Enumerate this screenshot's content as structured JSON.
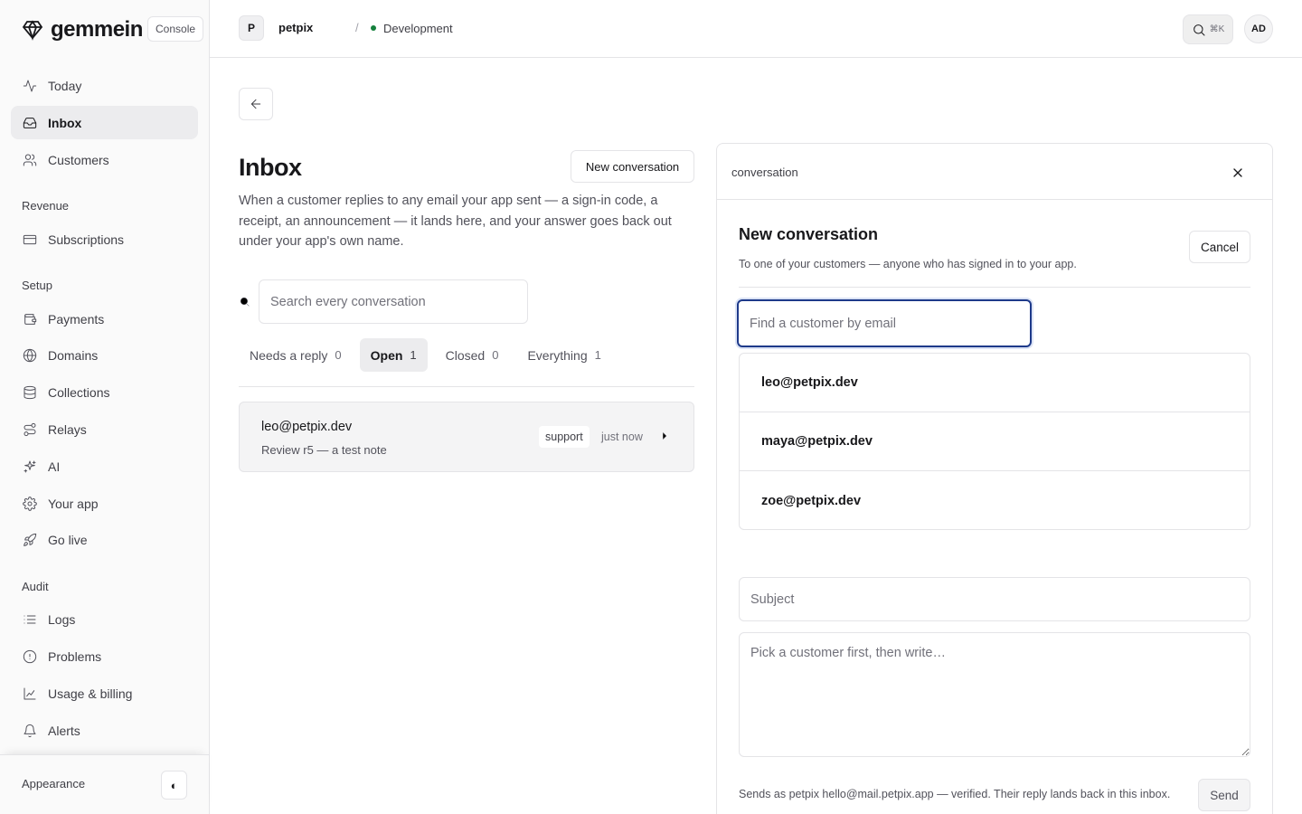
{
  "brand": {
    "name": "gemmein",
    "badge": "Console",
    "logo_icon": "gem-icon"
  },
  "sidebar": {
    "items": [
      {
        "label": "Today",
        "icon": "activity-icon",
        "active": false
      },
      {
        "label": "Inbox",
        "icon": "inbox-icon",
        "active": true
      },
      {
        "label": "Customers",
        "icon": "users-icon",
        "active": false
      }
    ],
    "sections": [
      {
        "title": "Revenue",
        "items": [
          {
            "label": "Subscriptions",
            "icon": "credit-card-icon"
          }
        ]
      },
      {
        "title": "Setup",
        "items": [
          {
            "label": "Payments",
            "icon": "wallet-icon"
          },
          {
            "label": "Domains",
            "icon": "globe-icon"
          },
          {
            "label": "Collections",
            "icon": "database-icon"
          },
          {
            "label": "Relays",
            "icon": "route-icon"
          },
          {
            "label": "AI",
            "icon": "sparkles-icon"
          },
          {
            "label": "Your app",
            "icon": "gear-icon"
          },
          {
            "label": "Go live",
            "icon": "rocket-icon"
          }
        ]
      },
      {
        "title": "Audit",
        "items": [
          {
            "label": "Logs",
            "icon": "list-icon"
          },
          {
            "label": "Problems",
            "icon": "alert-circle-icon"
          },
          {
            "label": "Usage & billing",
            "icon": "chart-icon"
          },
          {
            "label": "Alerts",
            "icon": "bell-icon"
          }
        ]
      }
    ],
    "footer": {
      "appearance_label": "Appearance",
      "toggle_glyph": "◐"
    }
  },
  "topbar": {
    "project_initial": "P",
    "project_name": "petpix",
    "separator": "/",
    "environment": "Development",
    "environment_color": "#15803d",
    "shortcut": "⌘K",
    "user_initials": "AD"
  },
  "main": {
    "title": "Inbox",
    "new_conversation_label": "New conversation",
    "description": "When a customer replies to any email your app sent — a sign-in code, a receipt, an announcement — it lands here, and your answer goes back out under your app's own name.",
    "search_placeholder": "Search every conversation",
    "tabs": [
      {
        "label": "Needs a reply",
        "count": "0",
        "active": false
      },
      {
        "label": "Open",
        "count": "1",
        "active": true
      },
      {
        "label": "Closed",
        "count": "0",
        "active": false
      },
      {
        "label": "Everything",
        "count": "1",
        "active": false
      }
    ],
    "conversations": [
      {
        "email": "leo@petpix.dev",
        "subject": "Review r5 — a test note",
        "tag": "support",
        "time": "just now"
      }
    ]
  },
  "panel": {
    "title": "conversation",
    "form_title": "New conversation",
    "form_subtitle": "To one of your customers — anyone who has signed in to your app.",
    "cancel_label": "Cancel",
    "find_placeholder": "Find a customer by email",
    "customers": [
      "leo@petpix.dev",
      "maya@petpix.dev",
      "zoe@petpix.dev"
    ],
    "subject_placeholder": "Subject",
    "body_placeholder": "Pick a customer first, then write…",
    "sends_note": "Sends as petpix hello@mail.petpix.app — verified. Their reply lands back in this inbox.",
    "send_label": "Send"
  },
  "colors": {
    "accent_focus": "#1e3a8a",
    "active_nav_bg": "#ececee"
  }
}
